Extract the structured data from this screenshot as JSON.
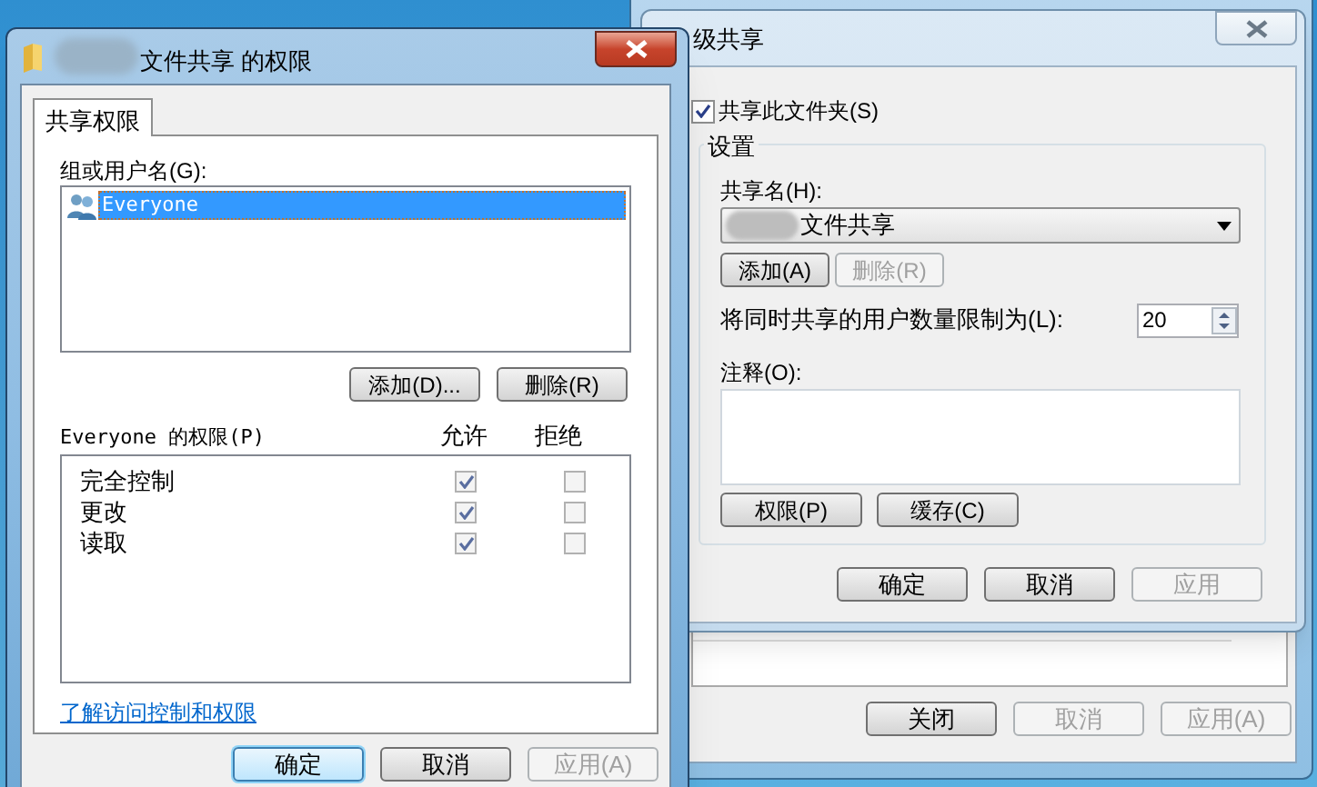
{
  "properties_window": {
    "buttons": [
      {
        "label": "关闭",
        "disabled": false,
        "focused": false
      },
      {
        "label": "取消",
        "disabled": true,
        "focused": false
      },
      {
        "label": "应用(A)",
        "disabled": true,
        "focused": false
      }
    ]
  },
  "advanced_sharing_window": {
    "title": "级共享",
    "share_checkbox": {
      "label": "共享此文件夹(S)",
      "checked": true
    },
    "settings": {
      "title": "设置",
      "share_name_label": "共享名(H):",
      "share_name": "文件共享",
      "name_buttons": [
        {
          "label": "添加(A)",
          "disabled": false,
          "focused": false
        },
        {
          "label": "删除(R)",
          "disabled": true,
          "focused": false
        }
      ],
      "limit_label": "将同时共享的用户数量限制为(L):",
      "limit_value": "20",
      "comment_label": "注释(O):",
      "extra_buttons": [
        {
          "label": "权限(P)",
          "disabled": false,
          "focused": false
        },
        {
          "label": "缓存(C)",
          "disabled": false,
          "focused": false
        }
      ]
    },
    "buttons": [
      {
        "label": "确定",
        "disabled": false,
        "focused": false
      },
      {
        "label": "取消",
        "disabled": false,
        "focused": false
      },
      {
        "label": "应用",
        "disabled": true,
        "focused": false
      }
    ]
  },
  "permissions_window": {
    "title": "文件共享 的权限",
    "tabs": [
      {
        "label": "共享权限",
        "selected": true
      }
    ],
    "group_label": "组或用户名(G):",
    "users": [
      {
        "name": "Everyone",
        "selected": true
      }
    ],
    "user_buttons": [
      {
        "label": "添加(D)...",
        "disabled": false,
        "focused": false
      },
      {
        "label": "删除(R)",
        "disabled": false,
        "focused": false
      }
    ],
    "permissions_label": "Everyone 的权限(P)",
    "columns": [
      "允许",
      "拒绝"
    ],
    "permissions": [
      {
        "name": "完全控制",
        "allow": true,
        "deny": false
      },
      {
        "name": "更改",
        "allow": true,
        "deny": false
      },
      {
        "name": "读取",
        "allow": true,
        "deny": false
      }
    ],
    "link": "了解访问控制和权限",
    "buttons": [
      {
        "label": "确定",
        "disabled": false,
        "focused": true
      },
      {
        "label": "取消",
        "disabled": false,
        "focused": false
      },
      {
        "label": "应用(A)",
        "disabled": true,
        "focused": false
      }
    ]
  }
}
